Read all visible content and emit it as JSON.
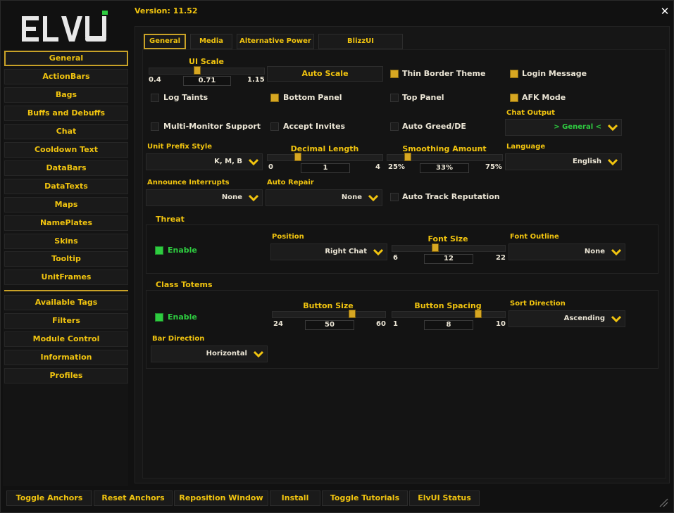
{
  "header": {
    "version_label": "Version: 11.52",
    "logo_text": "ELVUI"
  },
  "sidebar": {
    "items": [
      "General",
      "ActionBars",
      "Bags",
      "Buffs and Debuffs",
      "Chat",
      "Cooldown Text",
      "DataBars",
      "DataTexts",
      "Maps",
      "NamePlates",
      "Skins",
      "Tooltip",
      "UnitFrames"
    ],
    "items2": [
      "Available Tags",
      "Filters",
      "Module Control",
      "Information",
      "Profiles"
    ],
    "selected": "General"
  },
  "tabs": [
    "General",
    "Media",
    "Alternative Power",
    "BlizzUI Improvements"
  ],
  "general": {
    "ui_scale": {
      "label": "UI Scale",
      "min": "0.4",
      "value": "0.71",
      "max": "1.15",
      "fraction": 0.41
    },
    "auto_scale": "Auto Scale",
    "thin_border": {
      "label": "Thin Border Theme",
      "checked": true
    },
    "login_message": {
      "label": "Login Message",
      "checked": true
    },
    "log_taints": {
      "label": "Log Taints",
      "checked": false
    },
    "bottom_panel": {
      "label": "Bottom Panel",
      "checked": true
    },
    "top_panel": {
      "label": "Top Panel",
      "checked": false
    },
    "afk_mode": {
      "label": "AFK Mode",
      "checked": true
    },
    "multi_monitor": {
      "label": "Multi-Monitor Support",
      "checked": false
    },
    "accept_invites": {
      "label": "Accept Invites",
      "checked": false
    },
    "auto_greed": {
      "label": "Auto Greed/DE",
      "checked": false
    },
    "chat_output": {
      "label": "Chat Output",
      "value": "> General <"
    },
    "unit_prefix": {
      "label": "Unit Prefix Style",
      "value": "K, M, B"
    },
    "decimal_length": {
      "label": "Decimal Length",
      "min": "0",
      "value": "1",
      "max": "4",
      "fraction": 0.25
    },
    "smoothing": {
      "label": "Smoothing Amount",
      "min": "25%",
      "value": "33%",
      "max": "75%",
      "fraction": 0.16
    },
    "language": {
      "label": "Language",
      "value": "English"
    },
    "announce_interrupts": {
      "label": "Announce Interrupts",
      "value": "None"
    },
    "auto_repair": {
      "label": "Auto Repair",
      "value": "None"
    },
    "auto_track_rep": {
      "label": "Auto Track Reputation",
      "checked": false
    }
  },
  "threat": {
    "title": "Threat",
    "enable": {
      "label": "Enable",
      "checked": true
    },
    "position": {
      "label": "Position",
      "value": "Right Chat"
    },
    "font_size": {
      "label": "Font Size",
      "min": "6",
      "value": "12",
      "max": "22",
      "fraction": 0.375
    },
    "font_outline": {
      "label": "Font Outline",
      "value": "None"
    }
  },
  "totems": {
    "title": "Class Totems",
    "enable": {
      "label": "Enable",
      "checked": true
    },
    "button_size": {
      "label": "Button Size",
      "min": "24",
      "value": "50",
      "max": "60",
      "fraction": 0.72
    },
    "button_spacing": {
      "label": "Button Spacing",
      "min": "1",
      "value": "8",
      "max": "10",
      "fraction": 0.78
    },
    "sort_direction": {
      "label": "Sort Direction",
      "value": "Ascending"
    },
    "bar_direction": {
      "label": "Bar Direction",
      "value": "Horizontal"
    }
  },
  "bottom": [
    "Toggle Anchors",
    "Reset Anchors",
    "Reposition Window",
    "Install",
    "Toggle Tutorials",
    "ElvUI Status"
  ],
  "colors": {
    "accent": "#f1c40f",
    "enabled": "#2ecc40"
  },
  "icons": {
    "close": "close-icon",
    "dropdown": "chevron-down-icon",
    "resize": "resize-grip-icon"
  }
}
